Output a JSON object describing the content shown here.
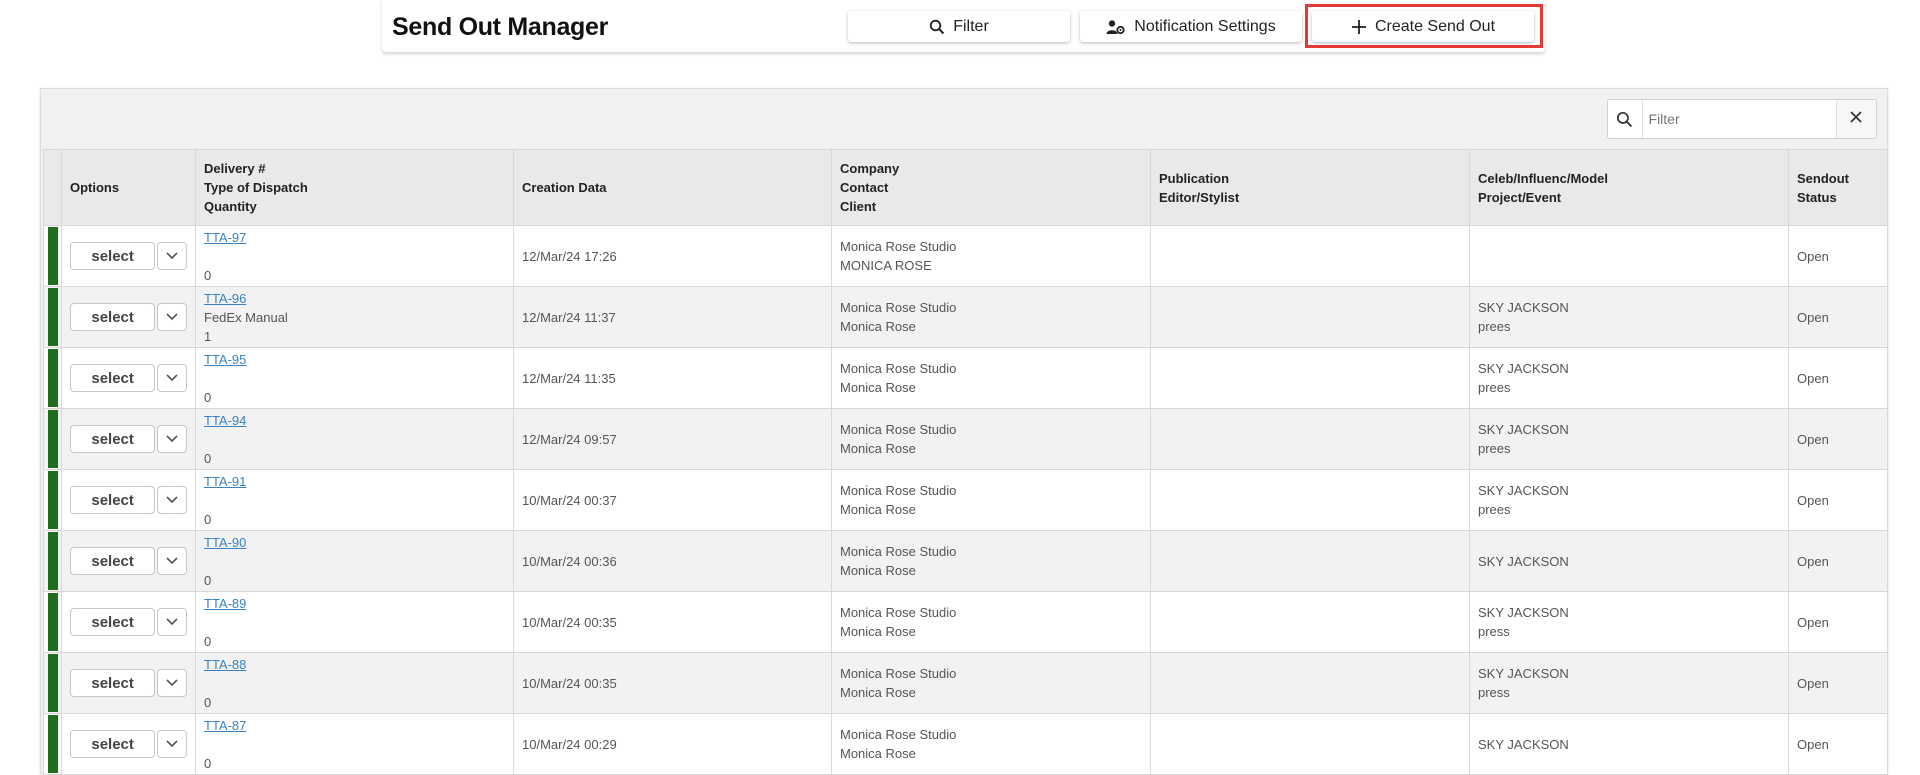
{
  "header": {
    "title": "Send Out Manager",
    "filter_label": "Filter",
    "notification_label": "Notification Settings",
    "create_label": "Create Send Out"
  },
  "search": {
    "placeholder": "Filter"
  },
  "columns": {
    "options": "Options",
    "delivery": [
      "Delivery #",
      "Type of Dispatch",
      "Quantity"
    ],
    "creation": "Creation Data",
    "company": [
      "Company",
      "Contact",
      "Client"
    ],
    "publication": [
      "Publication",
      "Editor/Stylist"
    ],
    "celeb": [
      "Celeb/Influenc/Model",
      "Project/Event"
    ],
    "status": [
      "Sendout",
      "Status"
    ]
  },
  "rows": [
    {
      "select": "select",
      "delivery": "TTA-97",
      "dispatch": "",
      "qty": "0",
      "created": "12/Mar/24 17:26",
      "company": "Monica Rose Studio",
      "contact": "MONICA ROSE",
      "pub": "",
      "celeb": "",
      "project": "",
      "status": "Open"
    },
    {
      "select": "select",
      "delivery": "TTA-96",
      "dispatch": "FedEx Manual",
      "qty": "1",
      "created": "12/Mar/24 11:37",
      "company": "Monica Rose Studio",
      "contact": "Monica Rose",
      "pub": "",
      "celeb": "SKY JACKSON",
      "project": "prees",
      "status": "Open"
    },
    {
      "select": "select",
      "delivery": "TTA-95",
      "dispatch": "",
      "qty": "0",
      "created": "12/Mar/24 11:35",
      "company": "Monica Rose Studio",
      "contact": "Monica Rose",
      "pub": "",
      "celeb": "SKY JACKSON",
      "project": "prees",
      "status": "Open"
    },
    {
      "select": "select",
      "delivery": "TTA-94",
      "dispatch": "",
      "qty": "0",
      "created": "12/Mar/24 09:57",
      "company": "Monica Rose Studio",
      "contact": "Monica Rose",
      "pub": "",
      "celeb": "SKY JACKSON",
      "project": "prees",
      "status": "Open"
    },
    {
      "select": "select",
      "delivery": "TTA-91",
      "dispatch": "",
      "qty": "0",
      "created": "10/Mar/24 00:37",
      "company": "Monica Rose Studio",
      "contact": "Monica Rose",
      "pub": "",
      "celeb": "SKY JACKSON",
      "project": "prees",
      "status": "Open"
    },
    {
      "select": "select",
      "delivery": "TTA-90",
      "dispatch": "",
      "qty": "0",
      "created": "10/Mar/24 00:36",
      "company": "Monica Rose Studio",
      "contact": "Monica Rose",
      "pub": "",
      "celeb": "SKY JACKSON",
      "project": "",
      "status": "Open"
    },
    {
      "select": "select",
      "delivery": "TTA-89",
      "dispatch": "",
      "qty": "0",
      "created": "10/Mar/24 00:35",
      "company": "Monica Rose Studio",
      "contact": "Monica Rose",
      "pub": "",
      "celeb": "SKY JACKSON",
      "project": "press",
      "status": "Open"
    },
    {
      "select": "select",
      "delivery": "TTA-88",
      "dispatch": "",
      "qty": "0",
      "created": "10/Mar/24 00:35",
      "company": "Monica Rose Studio",
      "contact": "Monica Rose",
      "pub": "",
      "celeb": "SKY JACKSON",
      "project": "press",
      "status": "Open"
    },
    {
      "select": "select",
      "delivery": "TTA-87",
      "dispatch": "",
      "qty": "0",
      "created": "10/Mar/24 00:29",
      "company": "Monica Rose Studio",
      "contact": "Monica Rose",
      "pub": "",
      "celeb": "SKY JACKSON",
      "project": "",
      "status": "Open"
    }
  ],
  "colors": {
    "accent_bar": "#1f6e1f",
    "link": "#3b82c4",
    "highlight": "#e53935"
  },
  "icons": [
    "search-icon",
    "user-gear-icon",
    "plus-icon",
    "close-icon",
    "chevron-down-icon"
  ]
}
